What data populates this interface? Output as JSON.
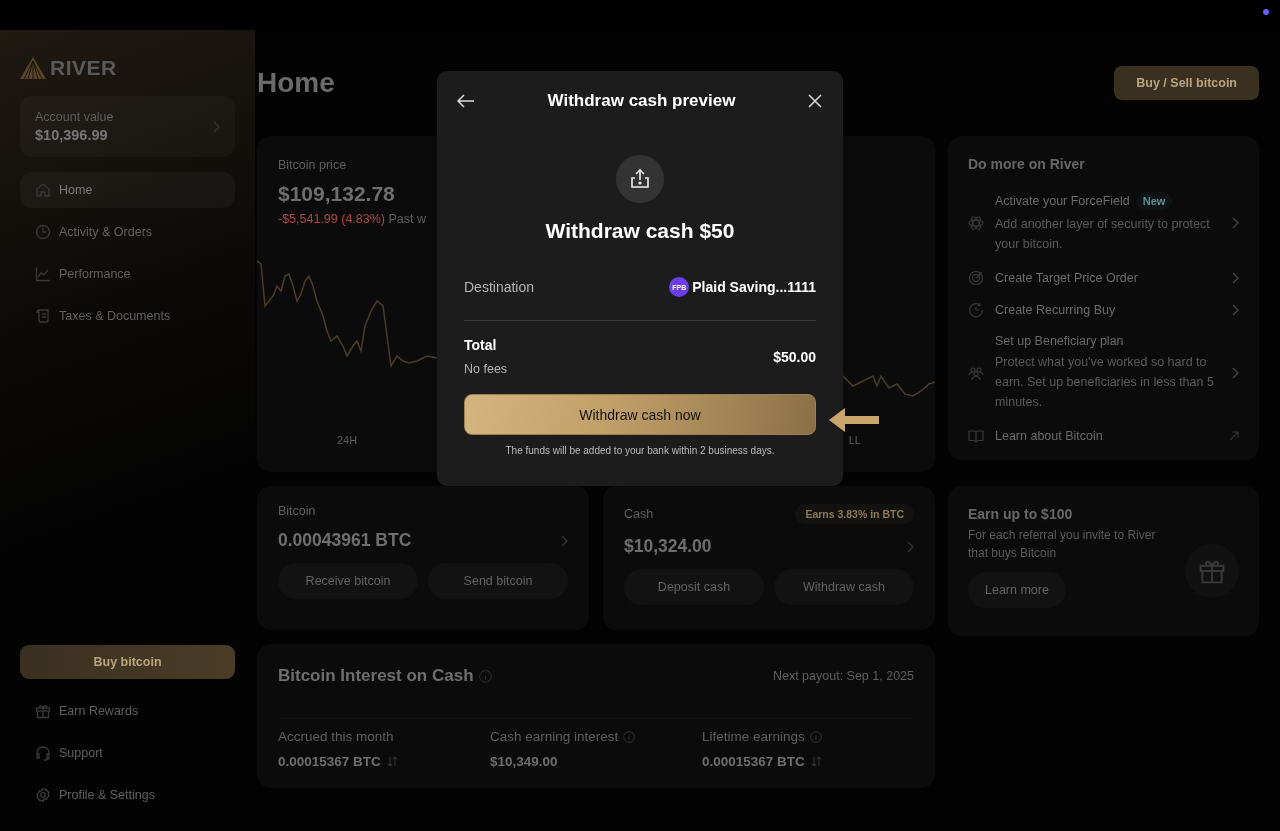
{
  "sidebar": {
    "logo": "RIVER",
    "account": {
      "label": "Account value",
      "value": "$10,396.99"
    },
    "nav": [
      {
        "label": "Home",
        "selected": true
      },
      {
        "label": "Activity & Orders",
        "selected": false
      },
      {
        "label": "Performance",
        "selected": false
      },
      {
        "label": "Taxes & Documents",
        "selected": false
      }
    ],
    "buy_button": "Buy bitcoin",
    "footer_nav": [
      {
        "label": "Earn Rewards"
      },
      {
        "label": "Support"
      },
      {
        "label": "Profile & Settings"
      }
    ]
  },
  "header": {
    "title": "Home",
    "action": "Buy / Sell bitcoin"
  },
  "price_card": {
    "label": "Bitcoin price",
    "price": "$109,132.78",
    "change": "-$5,541.99 (4.83%)",
    "period": "Past w",
    "ranges": [
      "24H",
      "LL"
    ]
  },
  "bitcoin_card": {
    "label": "Bitcoin",
    "value": "0.00043961 BTC",
    "actions": [
      "Receive bitcoin",
      "Send bitcoin"
    ]
  },
  "cash_card": {
    "label": "Cash",
    "badge": "Earns 3.83% in BTC",
    "value": "$10,324.00",
    "actions": [
      "Deposit cash",
      "Withdraw cash"
    ]
  },
  "interest_card": {
    "title": "Bitcoin Interest on Cash",
    "next_payout": "Next payout: Sep 1, 2025",
    "stats": [
      {
        "label": "Accrued this month",
        "value": "0.00015367 BTC",
        "info": false,
        "swap": true
      },
      {
        "label": "Cash earning interest",
        "value": "$10,349.00",
        "info": true,
        "swap": false
      },
      {
        "label": "Lifetime earnings",
        "value": "0.00015367 BTC",
        "info": true,
        "swap": true
      }
    ]
  },
  "do_more": {
    "title": "Do more on River",
    "items": [
      {
        "title": "Activate your ForceField",
        "badge": "New",
        "description": "Add another layer of security to protect your bitcoin.",
        "external": false
      },
      {
        "title": "Create Target Price Order",
        "external": false
      },
      {
        "title": "Create Recurring Buy",
        "external": false
      },
      {
        "title": "Set up Beneficiary plan",
        "description": "Protect what you've worked so hard to earn. Set up beneficiaries in less than 5 minutes.",
        "external": false
      },
      {
        "title": "Learn about Bitcoin",
        "external": true
      }
    ]
  },
  "referral": {
    "title": "Earn up to $100",
    "text": "For each referral you invite to River that buys Bitcoin",
    "button": "Learn more"
  },
  "modal": {
    "title": "Withdraw cash preview",
    "heading": "Withdraw cash $50",
    "destination_label": "Destination",
    "bank_logo": "FPB",
    "destination": "Plaid Saving...1111",
    "total_label": "Total",
    "fees": "No fees",
    "total": "$50.00",
    "button": "Withdraw cash now",
    "note": "The funds will be added to your bank within 2 business days."
  }
}
